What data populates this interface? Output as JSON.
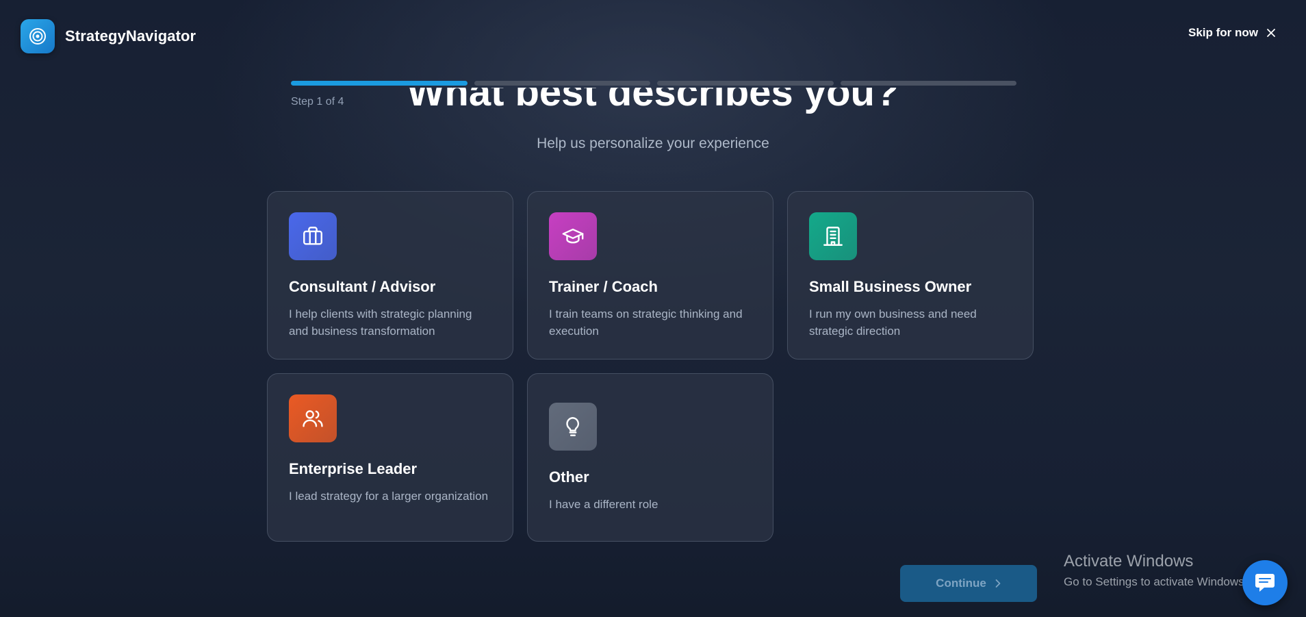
{
  "header": {
    "app_name": "StrategyNavigator",
    "logo_icon": "target-icon",
    "skip_label": "Skip for now",
    "skip_icon": "close-icon"
  },
  "progress": {
    "current_step": 1,
    "total_steps": 4,
    "step_label": "Step 1 of 4"
  },
  "main": {
    "title": "What best describes you?",
    "subtitle": "Help us personalize your experience"
  },
  "options": [
    {
      "title": "Consultant / Advisor",
      "description": "I help clients with strategic planning and business transformation",
      "icon": "briefcase-icon",
      "color": "#4a68ea"
    },
    {
      "title": "Trainer / Coach",
      "description": "I train teams on strategic thinking and execution",
      "icon": "graduation-cap-icon",
      "color": "#c73fc2"
    },
    {
      "title": "Small Business Owner",
      "description": "I run my own business and need strategic direction",
      "icon": "building-icon",
      "color": "#14a98a"
    },
    {
      "title": "Enterprise Leader",
      "description": "I lead strategy for a larger organization",
      "icon": "users-icon",
      "color": "#ea5a24"
    },
    {
      "title": "Other",
      "description": "I have a different role",
      "icon": "lightbulb-icon",
      "color": "#626b7b"
    }
  ],
  "footer": {
    "continue_label": "Continue",
    "continue_icon": "chevron-right-icon",
    "chat_icon": "chat-bubble-icon"
  },
  "watermark": {
    "line1": "Activate Windows",
    "line2": "Go to Settings to activate Windows."
  },
  "colors": {
    "accent": "#1b9be0",
    "background": "#1a2234",
    "card_border": "#454f62"
  }
}
